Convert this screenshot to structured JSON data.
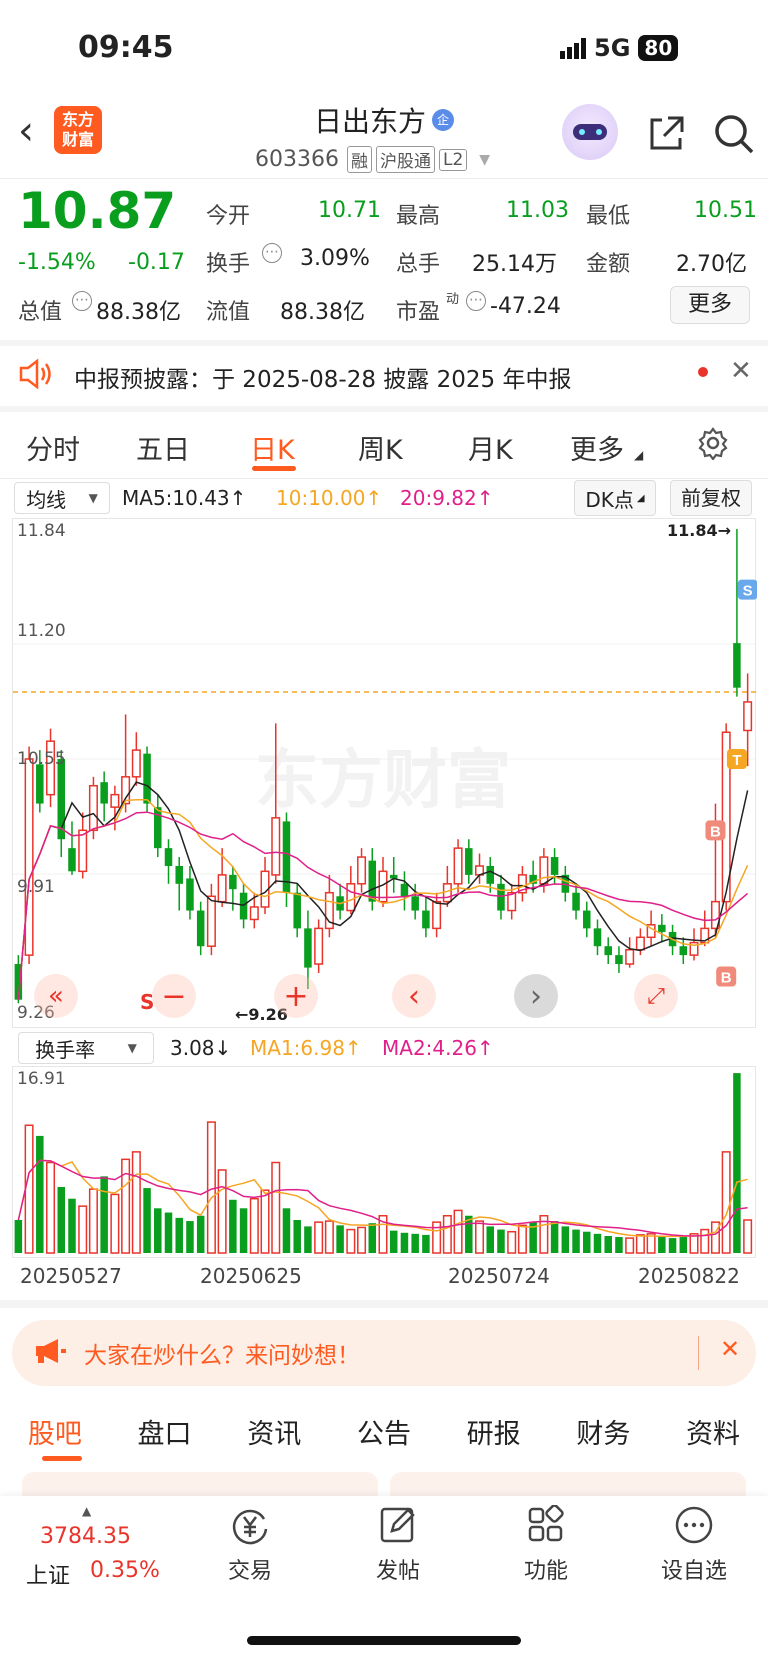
{
  "status": {
    "time": "09:45",
    "network": "5G",
    "battery": "80"
  },
  "header": {
    "logo_line1": "东方",
    "logo_line2": "财富",
    "name": "日出东方",
    "badge": "企",
    "code": "603366",
    "tags": [
      "融",
      "沪股通",
      "L2"
    ]
  },
  "quote": {
    "price": "10.87",
    "change_pct": "-1.54%",
    "change": "-0.17",
    "open_label": "今开",
    "open": "10.71",
    "high_label": "最高",
    "high": "11.03",
    "low_label": "最低",
    "low": "10.51",
    "turnover_label": "换手",
    "turnover": "3.09%",
    "volume_label": "总手",
    "volume": "25.14万",
    "amount_label": "金额",
    "amount": "2.70亿",
    "mcap_label": "总值",
    "mcap": "88.38亿",
    "float_label": "流值",
    "float": "88.38亿",
    "pe_label": "市盈",
    "pe_sup": "动",
    "pe": "-47.24",
    "more": "更多"
  },
  "notice": {
    "text": "中报预披露：于 2025-08-28 披露 2025 年中报"
  },
  "tabs": [
    "分时",
    "五日",
    "日K",
    "周K",
    "月K",
    "更多"
  ],
  "kline_bar": {
    "indicator": "均线",
    "ma5": "MA5:10.43↑",
    "ma10": "10:10.00↑",
    "ma20": "20:9.82↑",
    "dk": "DK点",
    "adjust": "前复权"
  },
  "chart_labels": {
    "y_top": "11.84",
    "y2": "11.20",
    "y3": "10.55",
    "y4": "9.91",
    "y_bottom": "9.26",
    "max_marker": "11.84→",
    "min_marker": "←9.26",
    "watermark": "东方财富"
  },
  "vol_bar": {
    "indicator": "换手率",
    "value": "3.08↓",
    "ma1": "MA1:6.98↑",
    "ma2": "MA2:4.26↑",
    "y_top": "16.91"
  },
  "dates": [
    "20250527",
    "20250625",
    "20250724",
    "20250822"
  ],
  "promo": {
    "text": "大家在炒什么？来问妙想！"
  },
  "sub_tabs": [
    "股吧",
    "盘口",
    "资讯",
    "公告",
    "研报",
    "财务",
    "资料"
  ],
  "bottom": {
    "index_value": "3784.35",
    "index_name": "上证",
    "index_pct": "0.35%",
    "trade": "交易",
    "post": "发帖",
    "func": "功能",
    "watch": "设自选"
  },
  "colors": {
    "up": "#e8342a",
    "down": "#0a9e1f",
    "accent": "#ff5a1f"
  },
  "chart_data": {
    "type": "candlestick",
    "ylim": [
      9.26,
      11.84
    ],
    "candles": [
      [
        9.4,
        9.2,
        9.45,
        9.18
      ],
      [
        9.45,
        10.55,
        10.62,
        9.4
      ],
      [
        10.52,
        10.3,
        10.6,
        10.25
      ],
      [
        10.35,
        10.65,
        10.72,
        10.28
      ],
      [
        10.55,
        10.1,
        10.6,
        10.0
      ],
      [
        10.05,
        9.92,
        10.2,
        9.9
      ],
      [
        9.92,
        10.15,
        10.25,
        9.88
      ],
      [
        10.15,
        10.4,
        10.45,
        10.1
      ],
      [
        10.42,
        10.3,
        10.48,
        10.2
      ],
      [
        10.28,
        10.35,
        10.4,
        10.15
      ],
      [
        10.3,
        10.45,
        10.8,
        10.25
      ],
      [
        10.45,
        10.6,
        10.7,
        10.4
      ],
      [
        10.58,
        10.3,
        10.62,
        10.25
      ],
      [
        10.28,
        10.05,
        10.35,
        10.0
      ],
      [
        10.05,
        9.95,
        10.1,
        9.85
      ],
      [
        9.95,
        9.85,
        10.0,
        9.7
      ],
      [
        9.88,
        9.7,
        9.95,
        9.65
      ],
      [
        9.7,
        9.5,
        9.75,
        9.45
      ],
      [
        9.5,
        9.78,
        9.85,
        9.45
      ],
      [
        9.75,
        9.9,
        10.05,
        9.72
      ],
      [
        9.9,
        9.82,
        9.95,
        9.7
      ],
      [
        9.8,
        9.65,
        9.85,
        9.6
      ],
      [
        9.65,
        9.72,
        9.8,
        9.6
      ],
      [
        9.72,
        9.92,
        10.0,
        9.68
      ],
      [
        9.9,
        10.22,
        10.75,
        9.85
      ],
      [
        10.2,
        9.8,
        10.25,
        9.72
      ],
      [
        9.8,
        9.6,
        9.85,
        9.55
      ],
      [
        9.6,
        9.38,
        9.7,
        9.26
      ],
      [
        9.4,
        9.6,
        9.65,
        9.35
      ],
      [
        9.6,
        9.8,
        9.9,
        9.55
      ],
      [
        9.78,
        9.7,
        9.85,
        9.65
      ],
      [
        9.7,
        9.85,
        9.95,
        9.68
      ],
      [
        9.85,
        10.0,
        10.05,
        9.8
      ],
      [
        9.98,
        9.75,
        10.05,
        9.7
      ],
      [
        9.75,
        9.92,
        10.0,
        9.72
      ],
      [
        9.9,
        9.88,
        10.0,
        9.8
      ],
      [
        9.85,
        9.78,
        9.92,
        9.7
      ],
      [
        9.78,
        9.7,
        9.85,
        9.65
      ],
      [
        9.7,
        9.6,
        9.78,
        9.55
      ],
      [
        9.6,
        9.75,
        9.8,
        9.55
      ],
      [
        9.75,
        9.85,
        9.95,
        9.72
      ],
      [
        9.85,
        10.05,
        10.1,
        9.8
      ],
      [
        10.05,
        9.9,
        10.1,
        9.85
      ],
      [
        9.9,
        9.95,
        10.02,
        9.85
      ],
      [
        9.95,
        9.85,
        10.0,
        9.8
      ],
      [
        9.85,
        9.7,
        9.9,
        9.65
      ],
      [
        9.7,
        9.8,
        9.85,
        9.65
      ],
      [
        9.8,
        9.9,
        9.95,
        9.75
      ],
      [
        9.9,
        9.85,
        9.98,
        9.8
      ],
      [
        9.85,
        10.0,
        10.05,
        9.8
      ],
      [
        10.0,
        9.9,
        10.05,
        9.85
      ],
      [
        9.9,
        9.8,
        9.95,
        9.75
      ],
      [
        9.8,
        9.7,
        9.85,
        9.65
      ],
      [
        9.7,
        9.6,
        9.75,
        9.55
      ],
      [
        9.6,
        9.5,
        9.65,
        9.45
      ],
      [
        9.5,
        9.45,
        9.55,
        9.4
      ],
      [
        9.45,
        9.4,
        9.5,
        9.35
      ],
      [
        9.4,
        9.48,
        9.55,
        9.38
      ],
      [
        9.48,
        9.55,
        9.6,
        9.45
      ],
      [
        9.55,
        9.62,
        9.7,
        9.5
      ],
      [
        9.62,
        9.58,
        9.68,
        9.52
      ],
      [
        9.58,
        9.5,
        9.62,
        9.45
      ],
      [
        9.5,
        9.45,
        9.55,
        9.4
      ],
      [
        9.45,
        9.52,
        9.6,
        9.42
      ],
      [
        9.52,
        9.6,
        9.7,
        9.5
      ],
      [
        9.6,
        9.75,
        10.3,
        9.55
      ],
      [
        9.75,
        10.7,
        10.75,
        9.7
      ],
      [
        11.2,
        10.95,
        11.84,
        10.9
      ],
      [
        10.71,
        10.87,
        11.03,
        10.51
      ]
    ],
    "turnover": [
      3.1,
      12.0,
      11.0,
      8.5,
      6.2,
      5.1,
      4.4,
      6.0,
      7.2,
      5.5,
      8.8,
      9.5,
      6.1,
      4.2,
      3.8,
      3.3,
      3.0,
      3.5,
      12.3,
      7.8,
      5.0,
      4.2,
      5.1,
      5.9,
      8.5,
      4.2,
      3.1,
      2.5,
      2.9,
      3.0,
      2.6,
      2.2,
      2.4,
      2.8,
      3.5,
      2.1,
      1.9,
      1.8,
      1.7,
      2.9,
      3.5,
      4.0,
      3.5,
      3.0,
      2.5,
      2.2,
      2.0,
      2.6,
      2.9,
      3.5,
      3.0,
      2.5,
      2.2,
      2.0,
      1.8,
      1.6,
      1.5,
      1.4,
      1.7,
      1.8,
      1.5,
      1.4,
      1.5,
      1.8,
      2.2,
      2.9,
      9.5,
      16.9,
      3.1
    ],
    "xlabels": [
      "20250527",
      "20250625",
      "20250724",
      "20250822"
    ]
  }
}
